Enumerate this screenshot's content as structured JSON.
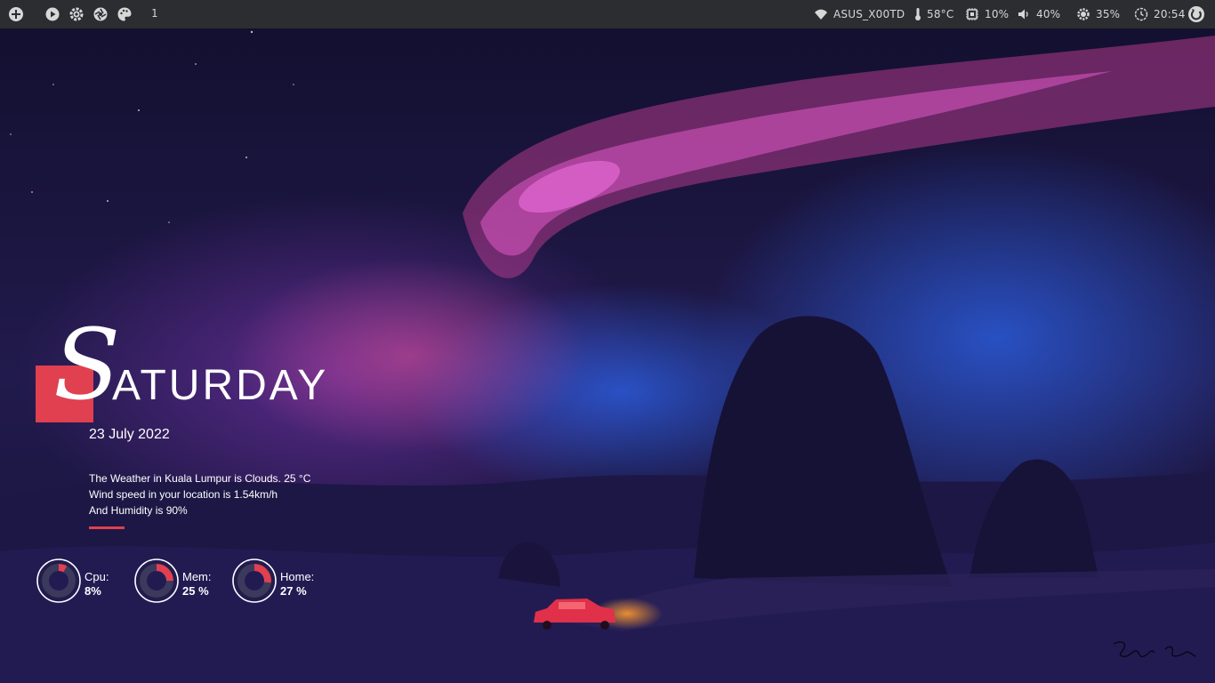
{
  "colors": {
    "bar_bg": "#2b2d31",
    "accent": "#e04050",
    "text": "#ffffff"
  },
  "topbar": {
    "left_icons": [
      "add-icon",
      "play-icon",
      "gear-icon",
      "aperture-icon",
      "palette-icon"
    ],
    "workspace": "1",
    "wifi": "ASUS_X00TD",
    "temperature": "58°C",
    "cpu": "10%",
    "volume": "40%",
    "brightness": "35%",
    "clock": "20:54"
  },
  "conky": {
    "day_initial": "S",
    "day_rest": "ATURDAY",
    "date": "23 July 2022",
    "weather": {
      "line1": "The Weather in Kuala Lumpur is Clouds. 25 °C",
      "line2": "Wind speed in your location is 1.54km/h",
      "line3": "And Humidity is 90%"
    },
    "gauges": [
      {
        "label": "Cpu:",
        "value": "8%",
        "fraction": 0.08
      },
      {
        "label": "Mem:",
        "value": "25 %",
        "fraction": 0.25
      },
      {
        "label": "Home:",
        "value": "27 %",
        "fraction": 0.27
      }
    ]
  }
}
